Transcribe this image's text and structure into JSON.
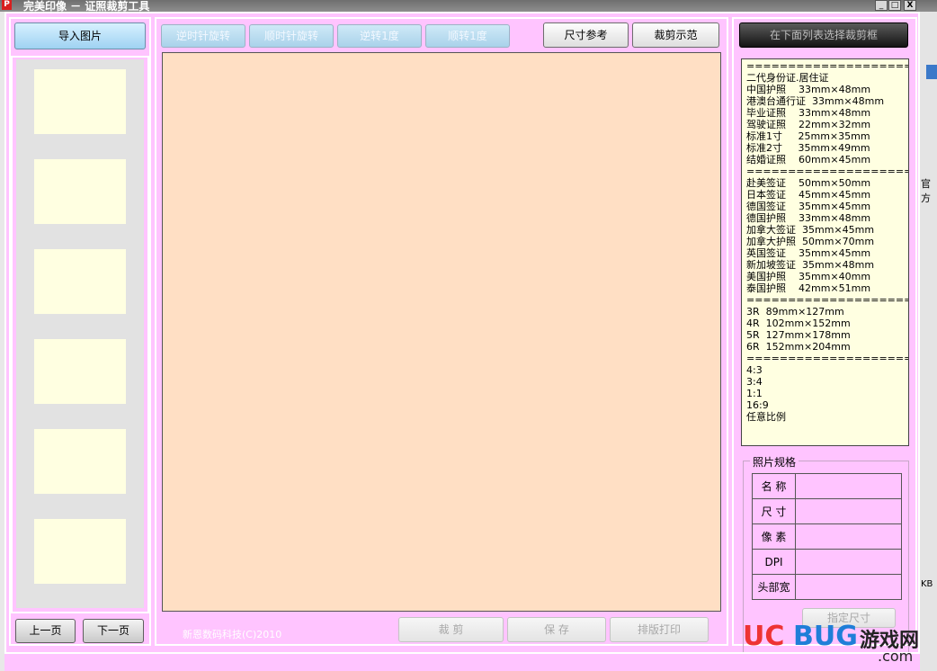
{
  "window": {
    "title": "完美印像 － 证照裁剪工具",
    "app_icon": "P",
    "minimize": "_",
    "maximize": "□",
    "close": "X"
  },
  "left": {
    "import_button": "导入图片",
    "prev_button": "上一页",
    "next_button": "下一页",
    "thumb_count": 6
  },
  "toolbar": {
    "rotate_ccw": "逆时针旋转",
    "rotate_cw": "顺时针旋转",
    "rotate_ccw_1": "逆转1度",
    "rotate_cw_1": "顺转1度",
    "size_ref": "尺寸参考",
    "crop_demo": "裁剪示范"
  },
  "bottom": {
    "copyright": "新恩数码科技(C)2010",
    "crop": "裁 剪",
    "save": "保 存",
    "print": "排版打印"
  },
  "right": {
    "select_frame": "在下面列表选择裁剪框",
    "ref_list": [
      "================================",
      "二代身份证.居住证",
      "中国护照    33mm×48mm",
      "港澳台通行证  33mm×48mm",
      "毕业证照    33mm×48mm",
      "驾驶证照    22mm×32mm",
      "标准1寸     25mm×35mm",
      "标准2寸     35mm×49mm",
      "结婚证照    60mm×45mm",
      "================================",
      "赴美签证    50mm×50mm",
      "日本签证    45mm×45mm",
      "德国签证    35mm×45mm",
      "德国护照    33mm×48mm",
      "加拿大签证  35mm×45mm",
      "加拿大护照  50mm×70mm",
      "英国签证    35mm×45mm",
      "新加坡签证  35mm×48mm",
      "美国护照    35mm×40mm",
      "泰国护照    42mm×51mm",
      "================================",
      "3R  89mm×127mm",
      "4R  102mm×152mm",
      "5R  127mm×178mm",
      "6R  152mm×204mm",
      "================================",
      "4:3",
      "3:4",
      "1:1",
      "16:9",
      "任意比例"
    ],
    "spec_legend": "照片规格",
    "spec_rows": [
      "名 称",
      "尺 寸",
      "像 素",
      "DPI",
      "头部宽"
    ],
    "fit_button": "指定尺寸"
  },
  "background": {
    "right_strip_text": "官方",
    "right_strip_text2": "KB"
  },
  "watermark": {
    "uc": "UC",
    "bug": "BUG",
    "cn": "游戏网",
    "com": ".com"
  },
  "colors": {
    "window_bg": "#ffc4ff",
    "canvas_bg": "#ffdfc4",
    "thumb_bg": "#ffffe1",
    "list_bg": "#ffffe1",
    "accent_blue": "#9fd2f2"
  }
}
